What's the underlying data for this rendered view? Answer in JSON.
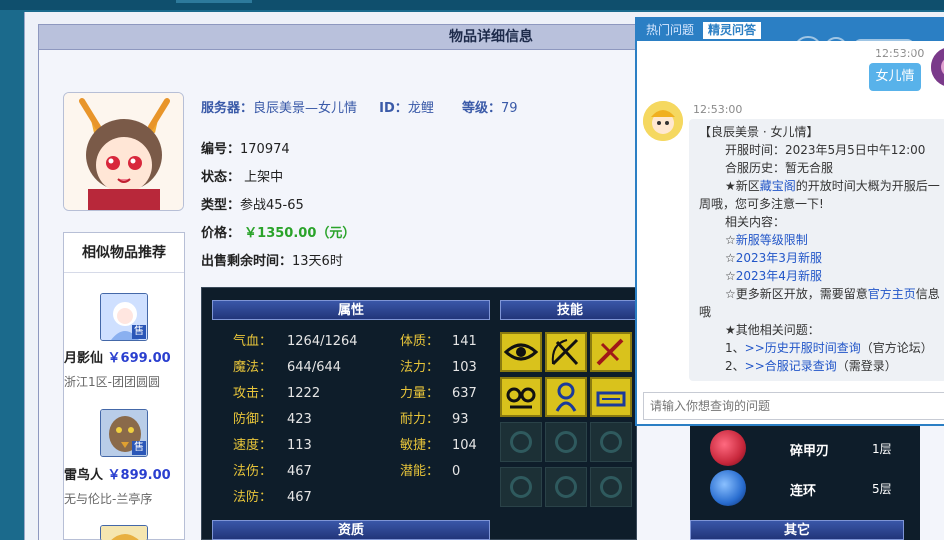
{
  "panel": {
    "title": "物品详细信息"
  },
  "item": {
    "server_label": "服务器：",
    "server_value": "良辰美景—女儿情",
    "id_label": "ID：",
    "id_value": "龙鲤",
    "level_label": "等级：",
    "level_value": "79",
    "number_label": "编号：",
    "number_value": "170974",
    "status_label": "状态：",
    "status_value": "上架中",
    "type_label": "类型：",
    "type_value": "参战45-65",
    "price_label": "价格：",
    "price_value": "￥1350.00（元）",
    "remaining_label": "出售剩余时间：",
    "remaining_value": "13天6时"
  },
  "similar": {
    "title": "相似物品推荐",
    "items": [
      {
        "name": "月影仙",
        "price": "￥699.00",
        "server": "浙江1区-团团圆圆",
        "tag": "售"
      },
      {
        "name": "雷鸟人",
        "price": "￥899.00",
        "server": "无与伦比-兰亭序",
        "tag": "售"
      }
    ]
  },
  "attributes": {
    "section_title": "属性",
    "skills_title": "技能",
    "bottom_title": "资质",
    "other_title": "其它",
    "left_stats": [
      {
        "k": "气血：",
        "v": "1264/1264"
      },
      {
        "k": "魔法：",
        "v": "644/644"
      },
      {
        "k": "攻击：",
        "v": "1222"
      },
      {
        "k": "防御：",
        "v": "423"
      },
      {
        "k": "速度：",
        "v": "113"
      },
      {
        "k": "法伤：",
        "v": "467"
      },
      {
        "k": "法防：",
        "v": "467"
      }
    ],
    "right_stats": [
      {
        "k": "体质：",
        "v": "141"
      },
      {
        "k": "法力：",
        "v": "103"
      },
      {
        "k": "力量：",
        "v": "637"
      },
      {
        "k": "耐力：",
        "v": "93"
      },
      {
        "k": "敏捷：",
        "v": "104"
      },
      {
        "k": "潜能：",
        "v": "0"
      }
    ]
  },
  "equip_list": [
    {
      "name": "碎甲刃",
      "level": "1层",
      "color": "#c8283c"
    },
    {
      "name": "连环",
      "level": "5层",
      "color": "#2a6ed0"
    }
  ],
  "chat": {
    "tab_hot": "热门问题",
    "tab_spirit": "精灵问答",
    "user_msg": "女儿情",
    "time_user": "12:53:00",
    "time_bot": "12:53:00",
    "bot": {
      "l1": "【良辰美景 · 女儿情】",
      "l2": "开服时间：2023年5月5日中午12:00",
      "l3": "合服历史：暂无合服",
      "l4a": "★新区",
      "l4b": "藏宝阁",
      "l4c": "的开放时间大概为开服后一",
      "l5": "周哦，您可多注意一下!",
      "l6": "相关内容：",
      "l7a": "☆",
      "l7b": "新服等级限制",
      "l8a": "☆",
      "l8b": "2023年3月新服",
      "l9a": "☆",
      "l9b": "2023年4月新服",
      "l10a": "☆更多新区开放，需要留意",
      "l10b": "官方主页",
      "l10c": "信息",
      "l11": "哦",
      "l12": "★其他相关问题：",
      "l13a": "1、",
      "l13b": ">>历史开服时间查询",
      "l13c": "（官方论坛）",
      "l14a": "2、",
      "l14b": ">>合服记录查询",
      "l14c": "（需登录）"
    },
    "input_placeholder": "请输入你想查询的问题"
  }
}
